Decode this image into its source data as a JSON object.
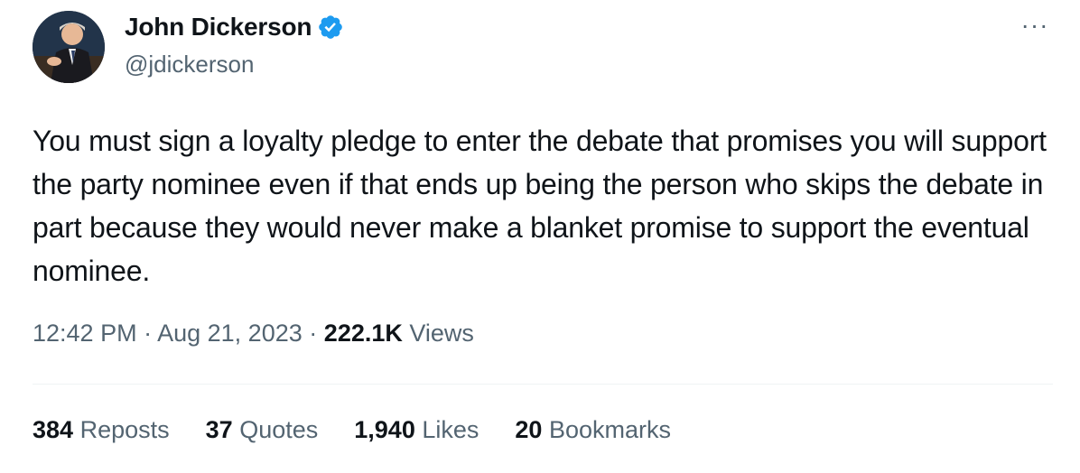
{
  "author": {
    "name": "John Dickerson",
    "handle": "@jdickerson",
    "verified": true
  },
  "more_label": "···",
  "tweet": {
    "text": "You must sign a loyalty pledge to enter the debate that promises you will support the party nominee even if that ends up being the person who skips the debate in part because they would never make a blanket promise to support the eventual nominee."
  },
  "meta": {
    "time": "12:42 PM",
    "sep": "·",
    "date": "Aug 21, 2023",
    "views_count": "222.1K",
    "views_label": "Views"
  },
  "stats": {
    "reposts_count": "384",
    "reposts_label": "Reposts",
    "quotes_count": "37",
    "quotes_label": "Quotes",
    "likes_count": "1,940",
    "likes_label": "Likes",
    "bookmarks_count": "20",
    "bookmarks_label": "Bookmarks"
  },
  "colors": {
    "verified_badge": "#1d9bf0",
    "text_primary": "#0f1419",
    "text_secondary": "#536471"
  }
}
